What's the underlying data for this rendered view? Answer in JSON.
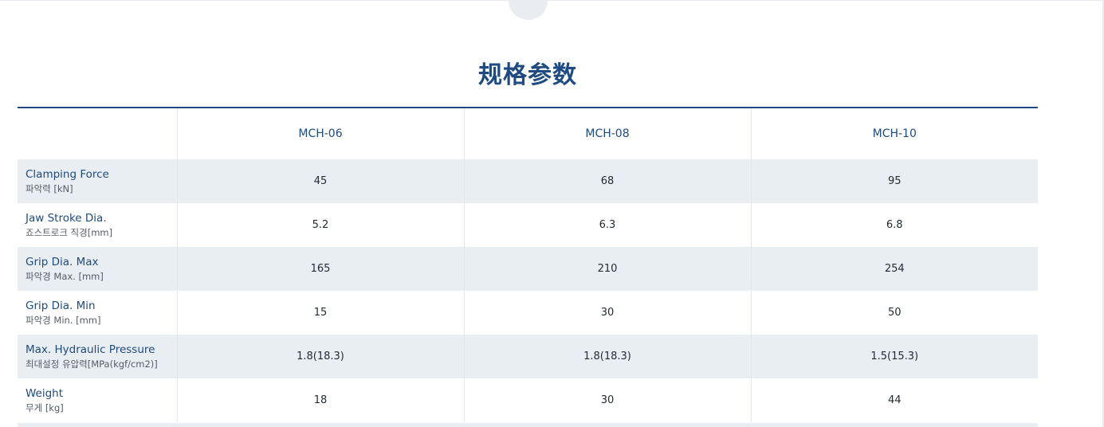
{
  "section": {
    "title": "规格参数"
  },
  "table": {
    "columns": [
      "MCH-06",
      "MCH-08",
      "MCH-10"
    ],
    "rows": [
      {
        "label_en": "Clamping Force",
        "label_ko": "파악력 [kN]",
        "values": [
          "45",
          "68",
          "95"
        ]
      },
      {
        "label_en": "Jaw Stroke Dia.",
        "label_ko": "죠스트로크 직경[mm]",
        "values": [
          "5.2",
          "6.3",
          "6.8"
        ]
      },
      {
        "label_en": "Grip Dia. Max",
        "label_ko": "파악경 Max. [mm]",
        "values": [
          "165",
          "210",
          "254"
        ]
      },
      {
        "label_en": "Grip Dia. Min",
        "label_ko": "파악경 Min. [mm]",
        "values": [
          "15",
          "30",
          "50"
        ]
      },
      {
        "label_en": "Max. Hydraulic Pressure",
        "label_ko": "최대설정 유압력[MPa(kgf/cm2)]",
        "values": [
          "1.8(18.3)",
          "1.8(18.3)",
          "1.5(15.3)"
        ]
      },
      {
        "label_en": "Weight",
        "label_ko": "무게 [kg]",
        "values": [
          "18",
          "30",
          "44"
        ]
      }
    ]
  },
  "colors": {
    "accent": "#1f4a82",
    "row_shade": "#e9eef3",
    "divider": "#e4e8ec"
  }
}
